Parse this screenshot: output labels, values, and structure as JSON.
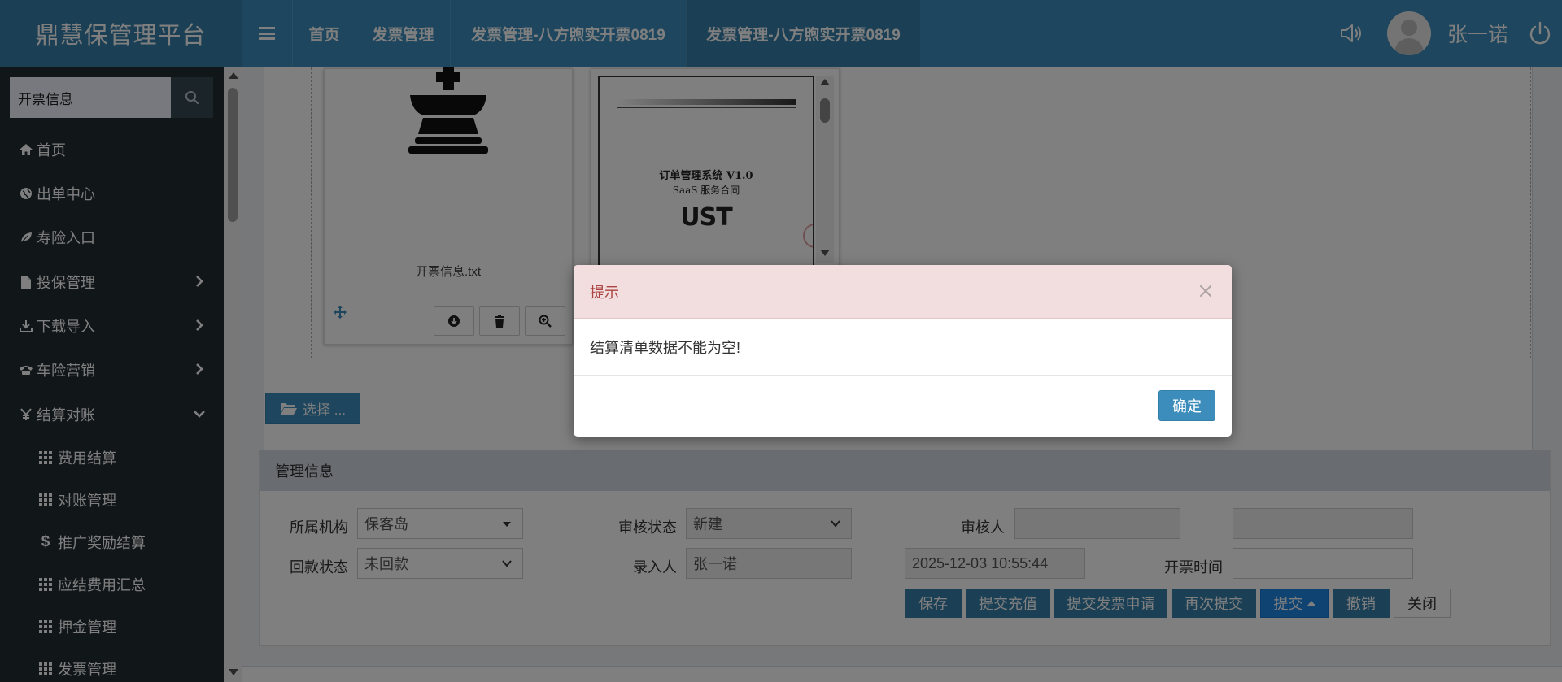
{
  "app": {
    "title": "鼎慧保管理平台"
  },
  "header": {
    "tabs": [
      {
        "label": "首页"
      },
      {
        "label": "发票管理"
      },
      {
        "label": "发票管理-八方煦实开票0819"
      },
      {
        "label": "发票管理-八方煦实开票0819"
      }
    ],
    "username": "张一诺"
  },
  "sidebar": {
    "search": {
      "value": "开票信息"
    },
    "items": [
      {
        "label": "首页",
        "icon": "home-icon"
      },
      {
        "label": "出单中心",
        "icon": "globe-icon"
      },
      {
        "label": "寿险入口",
        "icon": "leaf-icon"
      },
      {
        "label": "投保管理",
        "icon": "file-icon"
      },
      {
        "label": "下载导入",
        "icon": "download-icon"
      },
      {
        "label": "车险营销",
        "icon": "phone-icon"
      },
      {
        "label": "结算对账",
        "icon": "yen-icon"
      }
    ],
    "subitems": [
      {
        "label": "费用结算"
      },
      {
        "label": "对账管理"
      },
      {
        "label": "推广奖励结算"
      },
      {
        "label": "应结费用汇总"
      },
      {
        "label": "押金管理"
      },
      {
        "label": "发票管理"
      }
    ]
  },
  "upload": {
    "file1_name": "开票信息.txt",
    "doc_title": "订单管理系统 V1.0",
    "doc_subtitle": "SaaS 服务合同",
    "doc_logo": "UST",
    "select_label": "选择 ..."
  },
  "mgmt": {
    "title": "管理信息",
    "org_label": "所属机构",
    "org_value": "保客岛",
    "review_status_label": "审核状态",
    "review_status_value": "新建",
    "reviewer_label": "审核人",
    "reviewer_value": "",
    "payback_label": "回款状态",
    "payback_value": "未回款",
    "entry_label": "录入人",
    "entry_value": "张一诺",
    "entry_time": "2025-12-03 10:55:44",
    "invoice_time_label": "开票时间",
    "invoice_time_value": "",
    "buttons": {
      "save": "保存",
      "recharge": "提交充值",
      "invoice_apply": "提交发票申请",
      "resubmit": "再次提交",
      "submit": "提交",
      "revoke": "撤销",
      "close": "关闭"
    }
  },
  "modal": {
    "title": "提示",
    "message": "结算清单数据不能为空!",
    "ok": "确定"
  }
}
